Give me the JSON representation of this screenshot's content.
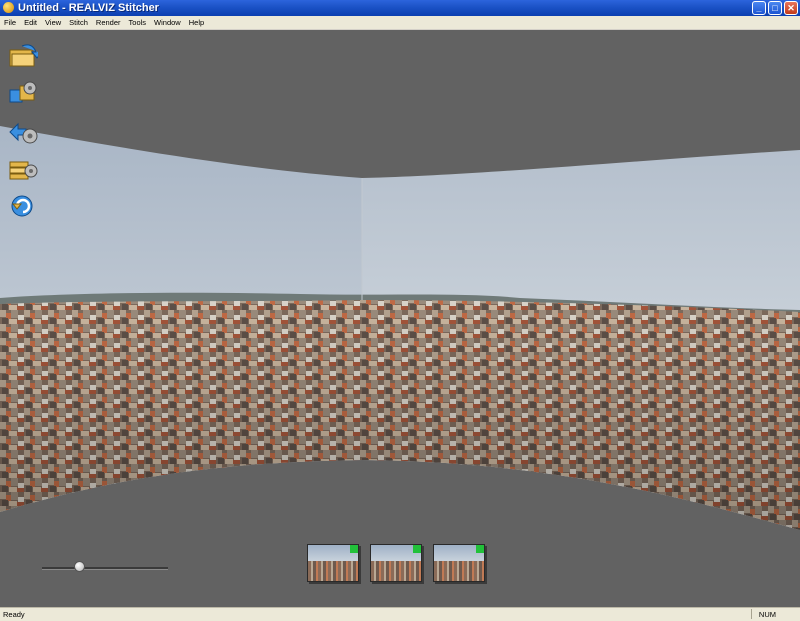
{
  "window": {
    "title": "Untitled - REALVIZ Stitcher",
    "buttons": {
      "minimize": "_",
      "maximize": "□",
      "close": "✕"
    }
  },
  "menu": [
    "File",
    "Edit",
    "View",
    "Stitch",
    "Render",
    "Tools",
    "Window",
    "Help"
  ],
  "toolbar": {
    "tools": [
      {
        "name": "add-images-tool",
        "icon": "folder-arrow-icon"
      },
      {
        "name": "stitch-tool",
        "icon": "puzzle-gear-icon"
      },
      {
        "name": "align-tool",
        "icon": "arrows-gear-icon"
      },
      {
        "name": "render-tool",
        "icon": "stack-gear-icon"
      },
      {
        "name": "undo-tool",
        "icon": "undo-arrow-icon"
      }
    ]
  },
  "thumbnails": [
    {
      "name": "image-1",
      "stitched": true
    },
    {
      "name": "image-2",
      "stitched": true
    },
    {
      "name": "image-3",
      "stitched": true
    }
  ],
  "zoom_slider": {
    "value": 0.3
  },
  "status": {
    "text": "Ready",
    "num": "NUM"
  },
  "colors": {
    "workspace": "#626262",
    "titlebar": "#1b52c6",
    "stitched_indicator": "#22c13a"
  }
}
